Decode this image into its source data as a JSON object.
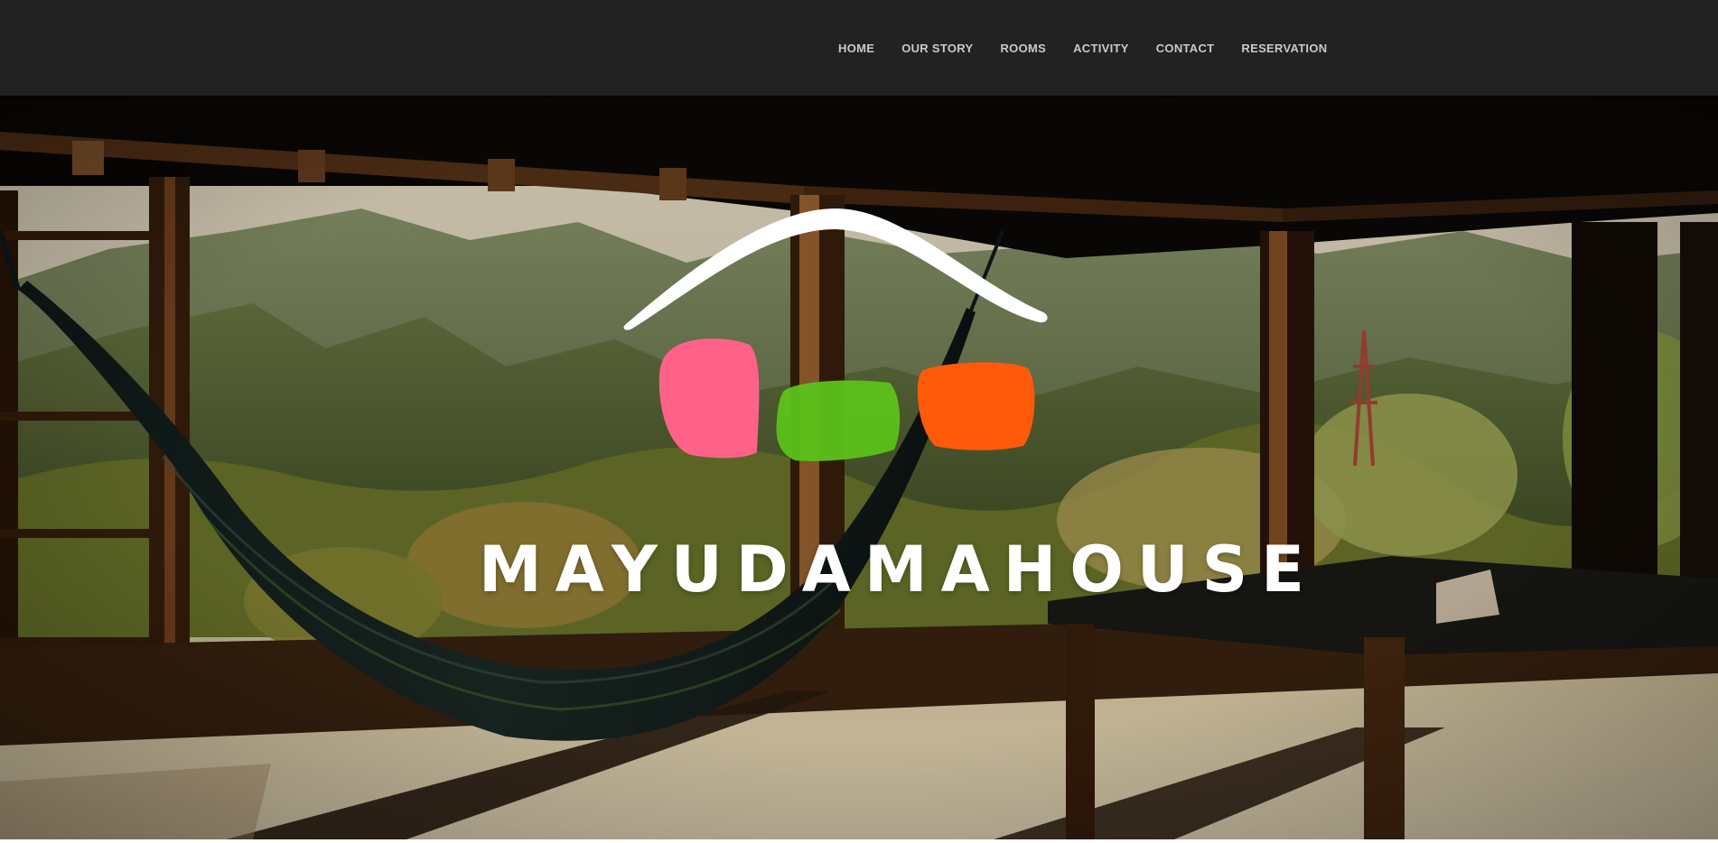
{
  "nav": {
    "items": [
      {
        "label": "HOME"
      },
      {
        "label": "OUR STORY"
      },
      {
        "label": "ROOMS"
      },
      {
        "label": "ACTIVITY"
      },
      {
        "label": "CONTACT"
      },
      {
        "label": "RESERVATION"
      }
    ]
  },
  "hero": {
    "brand_name": "MAYUDAMAHOUSE",
    "logo_colors": {
      "roof": "#ffffff",
      "pink": "#ff6289",
      "green": "#5cc21a",
      "orange": "#ff5a0a"
    },
    "background_image": "hammock-veranda-mountain-view"
  }
}
